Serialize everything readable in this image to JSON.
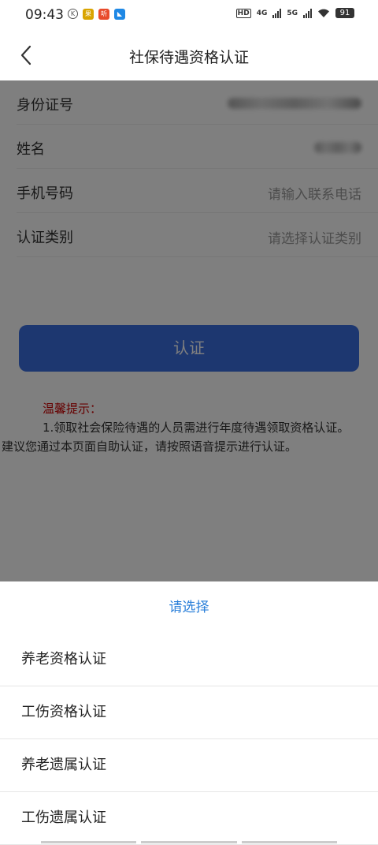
{
  "status_bar": {
    "time": "09:43",
    "app_icons": [
      {
        "name": "k-app-icon",
        "glyph": "K",
        "color": "#555555"
      },
      {
        "name": "news-app-icon",
        "glyph": "果",
        "color": "#d9a400"
      },
      {
        "name": "listen-app-icon",
        "glyph": "听",
        "color": "#e84a2b"
      },
      {
        "name": "bluefish-app-icon",
        "glyph": "◣",
        "color": "#1e88e5"
      }
    ],
    "hd_label": "HD",
    "net1": "4G",
    "net2": "5G",
    "battery": "91"
  },
  "nav": {
    "title": "社保待遇资格认证"
  },
  "form": {
    "id_label": "身份证号",
    "name_label": "姓名",
    "phone_label": "手机号码",
    "phone_placeholder": "请输入联系电话",
    "type_label": "认证类别",
    "type_placeholder": "请选择认证类别"
  },
  "submit_label": "认证",
  "tips": {
    "title": "温馨提示：",
    "line1": "1.领取社会保险待遇的人员需进行年度待遇领取资格认证。",
    "line2": "建议您通过本页面自助认证，请按照语音提示进行认证。"
  },
  "sheet": {
    "title": "请选择",
    "options": [
      "养老资格认证",
      "工伤资格认证",
      "养老遗属认证",
      "工伤遗属认证"
    ]
  }
}
